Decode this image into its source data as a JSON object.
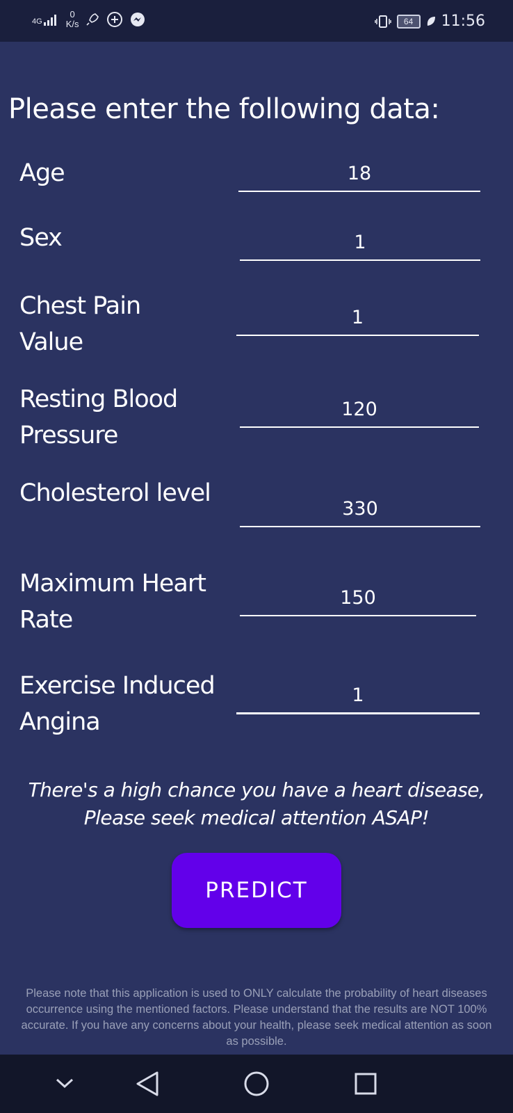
{
  "status_bar": {
    "network": "4G",
    "speed_value": "0",
    "speed_unit": "K/s",
    "battery": "64",
    "time": "11:56"
  },
  "form": {
    "title": "Please enter the following data:",
    "fields": [
      {
        "label": "Age",
        "value": "18"
      },
      {
        "label": "Sex",
        "value": "1"
      },
      {
        "label": "Chest Pain Value",
        "value": "1"
      },
      {
        "label": "Resting Blood Pressure",
        "value": "120"
      },
      {
        "label": "Cholesterol level",
        "value": "330"
      },
      {
        "label": "Maximum Heart Rate",
        "value": "150"
      },
      {
        "label": "Exercise Induced Angina",
        "value": "1"
      }
    ]
  },
  "result_message": "There's a high chance you have a heart disease, Please seek medical attention ASAP!",
  "predict_label": "PREDICT",
  "disclaimer": "Please note that this application is used to ONLY calculate the probability of heart diseases occurrence using the mentioned factors. Please understand that the results are NOT 100% accurate. If you have any concerns about your health, please seek medical attention as soon as possible.",
  "colors": {
    "background": "#2b3361",
    "button": "#6200ea",
    "disclaimer_text": "#9aa0b8"
  },
  "nav_bar": {
    "icons": [
      "chevron-down-icon",
      "back-triangle-icon",
      "home-circle-icon",
      "recents-square-icon"
    ]
  }
}
